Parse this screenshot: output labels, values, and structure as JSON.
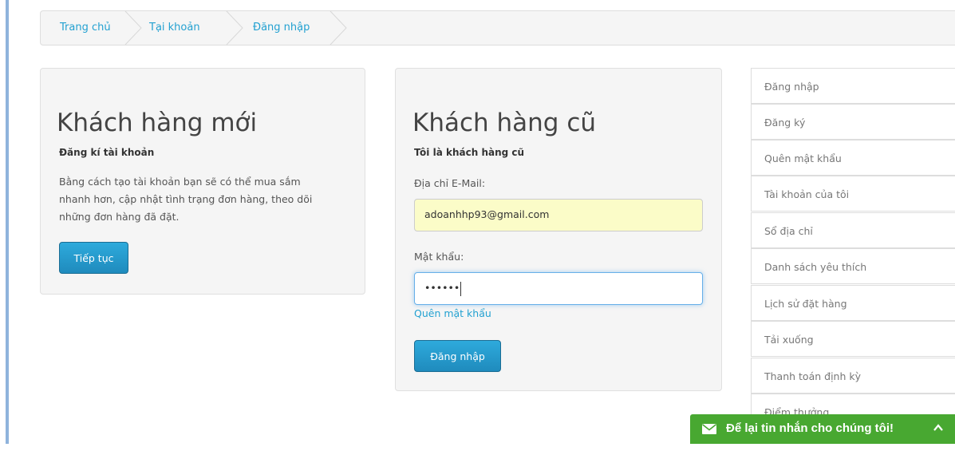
{
  "breadcrumb": {
    "items": [
      "Trang chủ",
      "Tại khoản",
      "Đăng nhập"
    ]
  },
  "new_customer": {
    "title": "Khách hàng mới",
    "subtitle": "Đăng kí tài khoản",
    "description_lines": [
      "Bằng cách tạo tài khoản bạn sẽ có thể mua sắm",
      "nhanh hơn, cập nhật tình trạng đơn hàng, theo dõi",
      "những đơn hàng đã đặt."
    ],
    "continue_label": "Tiếp tục"
  },
  "returning_customer": {
    "title": "Khách hàng cũ",
    "subtitle": "Tôi là khách hàng cũ",
    "email_label": "Địa chỉ E-Mail:",
    "email_value": "adoanhhp93@gmail.com",
    "password_label": "Mật khẩu:",
    "password_value": "••••••",
    "forgot_label": "Quên mật khẩu",
    "login_label": "Đăng nhập"
  },
  "sidebar": {
    "items": [
      {
        "label": "Đăng nhập"
      },
      {
        "label": "Đăng ký"
      },
      {
        "label": "Quên mật khẩu"
      },
      {
        "label": "Tài khoản của tôi"
      },
      {
        "label": "Sổ địa chỉ"
      },
      {
        "label": "Danh sách yêu thích"
      },
      {
        "label": "Lịch sử đặt hàng"
      },
      {
        "label": "Tải xuống"
      },
      {
        "label": "Thanh toán định kỳ"
      },
      {
        "label": "Điểm thưởng"
      }
    ]
  },
  "chat": {
    "label": "Để lại tin nhắn cho chúng tôi!",
    "icon": "envelope-icon",
    "toggle_icon": "chevron-up-icon"
  },
  "colors": {
    "link": "#23a1d1",
    "button": "#2299cc",
    "chat_bg": "#48a831",
    "autofill_bg": "#fbfcc8"
  }
}
